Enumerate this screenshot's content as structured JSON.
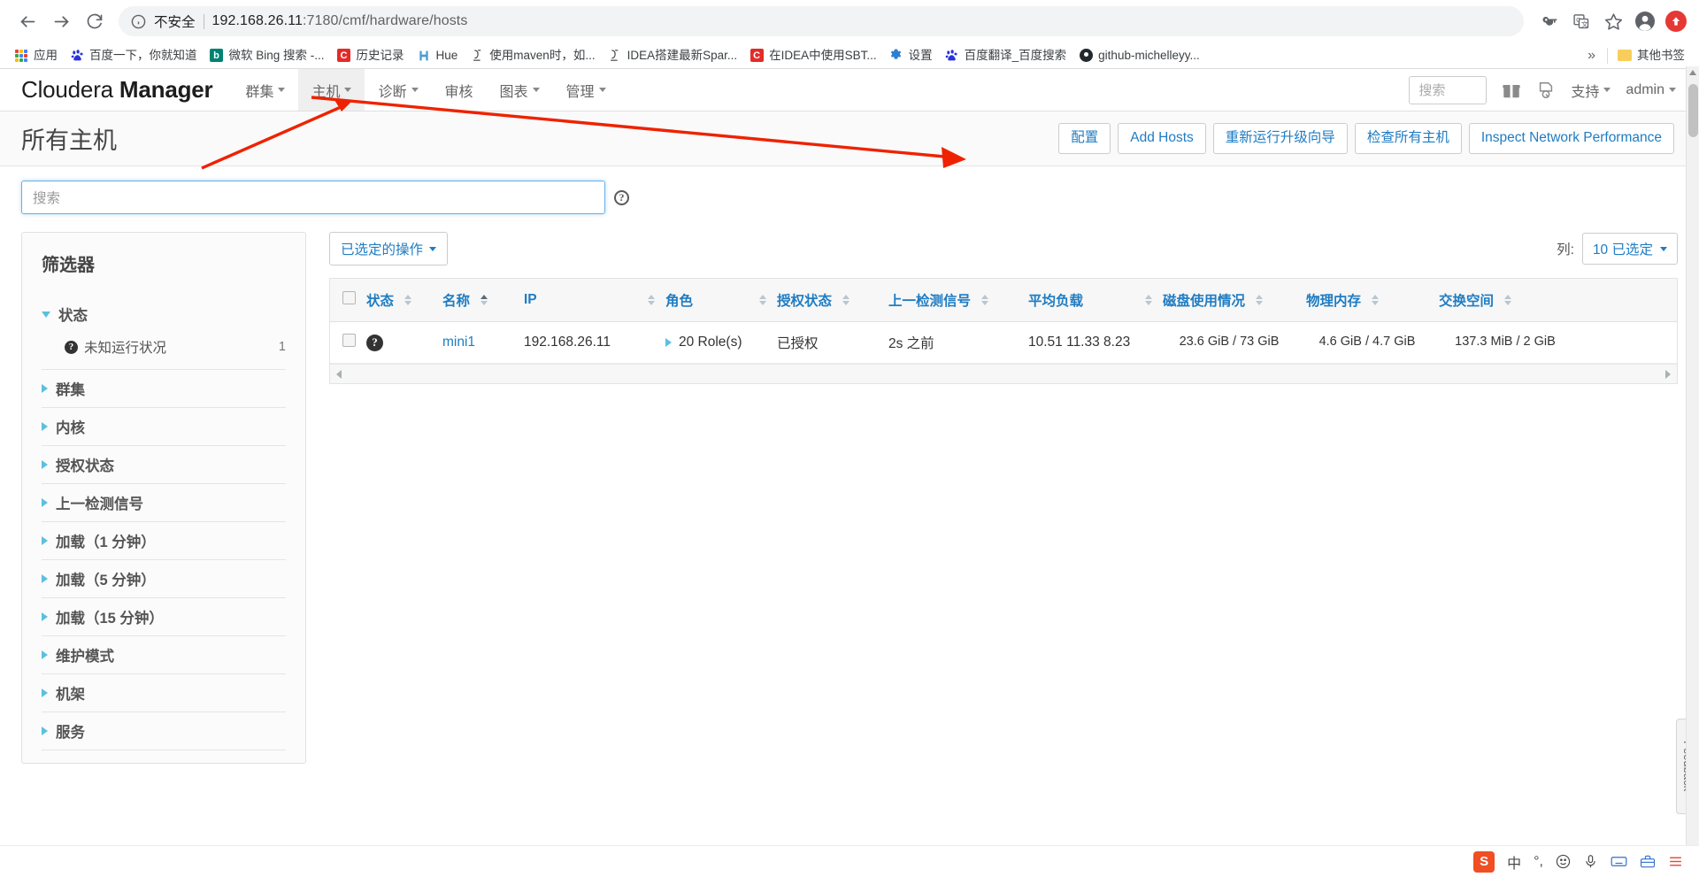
{
  "browser": {
    "back_icon": "back-arrow-icon",
    "forward_icon": "forward-arrow-icon",
    "reload_icon": "reload-icon",
    "security_label": "不安全",
    "url": "192.168.26.11:7180/cmf/hardware/hosts",
    "url_host": "192.168.26.11",
    "url_port_path": ":7180/cmf/hardware/hosts",
    "toolbar_icons": [
      "key-icon",
      "translate-icon",
      "bookmark-star-icon",
      "profile-avatar-icon",
      "update-arrow-icon"
    ],
    "bookmarks": [
      {
        "label": "应用",
        "icon": "apps-grid-icon"
      },
      {
        "label": "百度一下，你就知道",
        "icon": "baidu-icon"
      },
      {
        "label": "微软 Bing 搜索 -...",
        "icon": "bing-icon"
      },
      {
        "label": "历史记录",
        "icon": "cloudera-c-icon"
      },
      {
        "label": "Hue",
        "icon": "hue-icon"
      },
      {
        "label": "使用maven时，如...",
        "icon": "idea-icon"
      },
      {
        "label": "IDEA搭建最新Spar...",
        "icon": "idea-icon"
      },
      {
        "label": "在IDEA中使用SBT...",
        "icon": "cloudera-c-icon"
      },
      {
        "label": "设置",
        "icon": "gear-icon"
      },
      {
        "label": "百度翻译_百度搜索",
        "icon": "baidu-icon"
      },
      {
        "label": "github-michelleyy...",
        "icon": "github-icon"
      }
    ],
    "overflow_label": "»",
    "other_bookmarks": {
      "label": "其他书签",
      "icon": "folder-icon"
    }
  },
  "app": {
    "brand_light": "Cloudera",
    "brand_bold": "Manager",
    "menu": [
      {
        "label": "群集",
        "caret": true,
        "active": false
      },
      {
        "label": "主机",
        "caret": true,
        "active": true
      },
      {
        "label": "诊断",
        "caret": true,
        "active": false
      },
      {
        "label": "审核",
        "caret": false,
        "active": false
      },
      {
        "label": "图表",
        "caret": true,
        "active": false
      },
      {
        "label": "管理",
        "caret": true,
        "active": false
      }
    ],
    "search_placeholder": "搜索",
    "gift_icon": "gift-icon",
    "parcel_icon": "parcel-icon",
    "support_label": "支持",
    "user_label": "admin"
  },
  "page": {
    "title": "所有主机",
    "actions": [
      {
        "label": "配置",
        "name": "config-button"
      },
      {
        "label": "Add Hosts",
        "name": "add-hosts-button"
      },
      {
        "label": "重新运行升级向导",
        "name": "rerun-upgrade-wizard-button"
      },
      {
        "label": "检查所有主机",
        "name": "inspect-all-hosts-button"
      },
      {
        "label": "Inspect Network Performance",
        "name": "inspect-network-performance-button"
      }
    ],
    "search_placeholder": "搜索",
    "help_icon": "help-circle-icon"
  },
  "filters": {
    "title": "筛选器",
    "groups": [
      {
        "label": "状态",
        "expanded": true,
        "items": [
          {
            "label": "未知运行状况",
            "count": "1",
            "icon": "unknown-health-icon"
          }
        ]
      },
      {
        "label": "群集",
        "expanded": false,
        "items": []
      },
      {
        "label": "内核",
        "expanded": false,
        "items": []
      },
      {
        "label": "授权状态",
        "expanded": false,
        "items": []
      },
      {
        "label": "上一检测信号",
        "expanded": false,
        "items": []
      },
      {
        "label": "加载（1 分钟）",
        "expanded": false,
        "items": []
      },
      {
        "label": "加载（5 分钟）",
        "expanded": false,
        "items": []
      },
      {
        "label": "加载（15 分钟）",
        "expanded": false,
        "items": []
      },
      {
        "label": "维护模式",
        "expanded": false,
        "items": []
      },
      {
        "label": "机架",
        "expanded": false,
        "items": []
      },
      {
        "label": "服务",
        "expanded": false,
        "items": []
      }
    ]
  },
  "table": {
    "actions_button": "已选定的操作",
    "columns_label": "列:",
    "columns_selected": "10 已选定",
    "headers": [
      {
        "label": "状态",
        "sortable": true,
        "sorted": "none"
      },
      {
        "label": "名称",
        "sortable": true,
        "sorted": "asc"
      },
      {
        "label": "IP",
        "sortable": true,
        "sorted": "none"
      },
      {
        "label": "角色",
        "sortable": true,
        "sorted": "none"
      },
      {
        "label": "授权状态",
        "sortable": true,
        "sorted": "none"
      },
      {
        "label": "上一检测信号",
        "sortable": true,
        "sorted": "none"
      },
      {
        "label": "平均负载",
        "sortable": true,
        "sorted": "none"
      },
      {
        "label": "磁盘使用情况",
        "sortable": true,
        "sorted": "none"
      },
      {
        "label": "物理内存",
        "sortable": true,
        "sorted": "none"
      },
      {
        "label": "交换空间",
        "sortable": true,
        "sorted": "none"
      }
    ],
    "rows": [
      {
        "status_icon": "unknown-health-icon",
        "name": "mini1",
        "ip": "192.168.26.11",
        "roles": "20 Role(s)",
        "license": "已授权",
        "heartbeat": "2s 之前",
        "load": "10.51  11.33  8.23",
        "disk": {
          "text": "23.6 GiB / 73 GiB",
          "percent": 32,
          "color": "#5aa91b"
        },
        "memory": {
          "text": "4.6 GiB / 4.7 GiB",
          "percent": 98,
          "color": "#c00000"
        },
        "swap": {
          "text": "137.3 MiB / 2 GiB",
          "percent": 7,
          "color": "#5aa91b"
        }
      }
    ]
  },
  "feedback": {
    "label": "Feedback"
  },
  "tray": {
    "items": [
      "sogou-logo-icon",
      "中",
      "°,",
      "smiley-icon",
      "mic-icon",
      "keyboard-icon",
      "toolbox-icon",
      "menu-icon"
    ]
  }
}
